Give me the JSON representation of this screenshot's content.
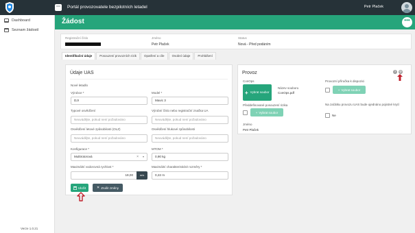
{
  "app": {
    "title": "Portál provozovatele bezpilotních letadel",
    "grid_icon": "grid-dots-icon",
    "user_name": "Petr Plaček",
    "version": "Verze 1.0.21",
    "colors": {
      "topbar": "#263238",
      "accent": "#26a57b",
      "arrow": "#c0202c"
    }
  },
  "sidebar": {
    "items": [
      {
        "label": "Dashboard",
        "icon": "dashboard-icon"
      },
      {
        "label": "Seznam žádostí",
        "icon": "list-icon"
      }
    ]
  },
  "page": {
    "title": "Žádost",
    "more_label": "•••"
  },
  "info": {
    "reg_label": "Registrační číslo",
    "name_label": "Jméno",
    "name_value": "Petr Plaček",
    "status_label": "Status",
    "status_value": "Nová - Před podáním"
  },
  "tabs": [
    {
      "label": "Identifikační údaje",
      "active": true
    },
    {
      "label": "Posouzení provozních rizik"
    },
    {
      "label": "Opatření a cíle"
    },
    {
      "label": "Osobní údaje"
    },
    {
      "label": "Prohlášení"
    }
  ],
  "uas": {
    "title": "Údaje UAS",
    "section": "Nové letadlo",
    "manufacturer_label": "Výrobce *",
    "manufacturer_value": "DJI",
    "model_label": "Model *",
    "model_value": "Mavic 3",
    "type_cert_label": "Typové osvědčení",
    "type_cert_placeholder": "Neuvádějte, pokud není požadováno",
    "serial_label": "Výrobní číslo nebo registrační značka UA",
    "serial_placeholder": "Neuvádějte, pokud není požadováno",
    "airworthiness_label": "Osvědčení letové způsobilosti (OLZ)",
    "airworthiness_placeholder": "Neuvádějte, pokud není požadováno",
    "noise_label": "Osvědčení hlukové způsobilosti",
    "noise_placeholder": "Neuvádějte, pokud není požadováno",
    "config_label": "Konfigurace *",
    "config_value": "Multirotorová",
    "config_clear": "×",
    "config_caret": "▾",
    "mtom_label": "MTOM *",
    "mtom_value": "0,90 kg",
    "speed_label": "Maximální vodorovná rychlost *",
    "speed_value": "19,00",
    "speed_unit": "m/s",
    "dimension_label": "Maximální charakteristické rozměry *",
    "dimension_value": "0,22 m",
    "save_label": "Uložit",
    "discard_label": "Zrušit změny"
  },
  "provoz": {
    "title": "Provoz",
    "conops_label": "ConOps",
    "upload_label": "Vybrat soubor",
    "file_name_label": "Název souboru",
    "file_name": "ConOps.pdf",
    "manual_label": "Provozní příručka k dispozici",
    "manual_upload_label": "Vybrat soubor",
    "risk_label": "Předdefinované posouzení rizika",
    "risk_upload_label": "Vybrat soubor",
    "initial_label": "Na začátku provozu UAS bude ujednáno pojistné krytí",
    "initial_value": "Ne",
    "name_label": "Jméno",
    "name_value": "Petr Plaček"
  }
}
